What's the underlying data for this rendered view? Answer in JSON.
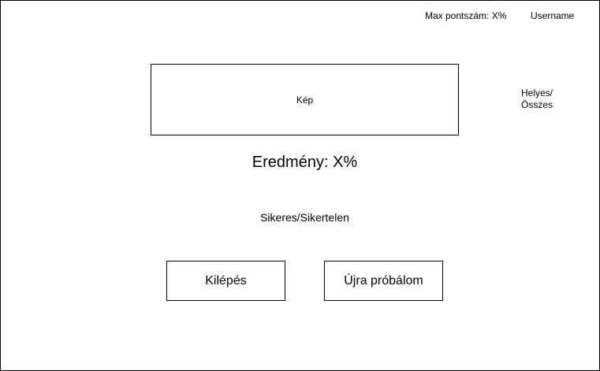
{
  "header": {
    "max_score": "Max pontszám: X%",
    "username": "Username"
  },
  "image_placeholder": {
    "label": "Kép"
  },
  "ratio": {
    "line1": "Helyes/",
    "line2": "Összes"
  },
  "result": {
    "text": "Eredmény: X%"
  },
  "status": {
    "text": "Sikeres/Sikertelen"
  },
  "buttons": {
    "exit_label": "Kilépés",
    "retry_label": "Újra próbálom"
  },
  "colors": {
    "border": "#000000",
    "background": "#ffffff",
    "text": "#000000"
  }
}
